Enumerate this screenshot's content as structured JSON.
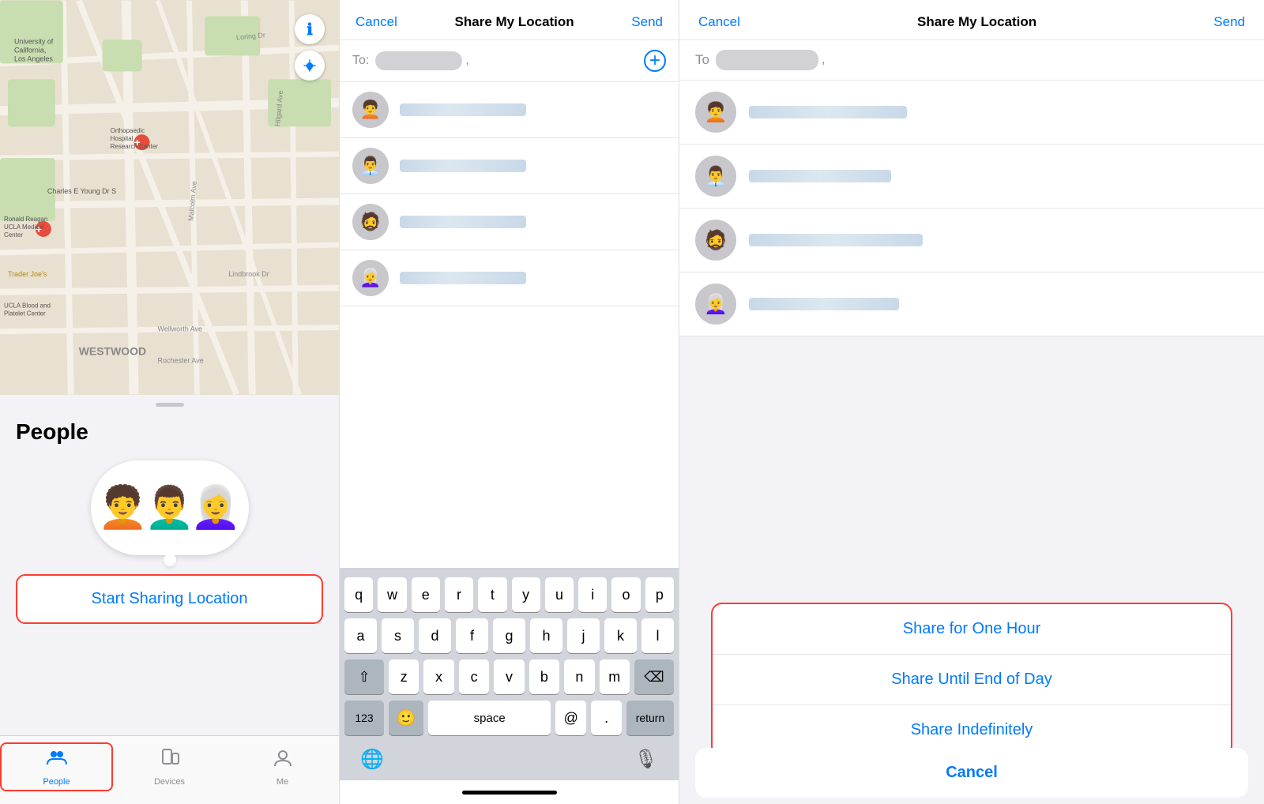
{
  "panel1": {
    "map": {
      "alt": "Map of Westwood area Los Angeles"
    },
    "drag_handle": true,
    "people_title": "People",
    "start_sharing_label": "Start Sharing Location",
    "tabs": [
      {
        "id": "people",
        "label": "People",
        "icon": "👤",
        "active": true
      },
      {
        "id": "devices",
        "label": "Devices",
        "icon": "📱",
        "active": false
      },
      {
        "id": "me",
        "label": "Me",
        "icon": "👤",
        "active": false
      }
    ]
  },
  "panel2": {
    "nav": {
      "cancel": "Cancel",
      "title": "Share My Location",
      "send": "Send"
    },
    "to_label": "To:",
    "add_btn": "+",
    "keyboard": {
      "rows": [
        [
          "q",
          "w",
          "e",
          "r",
          "t",
          "y",
          "u",
          "i",
          "o",
          "p"
        ],
        [
          "a",
          "s",
          "d",
          "f",
          "g",
          "h",
          "j",
          "k",
          "l"
        ],
        [
          "⇧",
          "z",
          "x",
          "c",
          "v",
          "b",
          "n",
          "m",
          "⌫"
        ],
        [
          "123",
          "🙂",
          "space",
          "@",
          ".",
          "return"
        ]
      ]
    },
    "contacts": [
      {
        "id": 1,
        "emoji": "🧑‍🦱"
      },
      {
        "id": 2,
        "emoji": "👨‍💼"
      },
      {
        "id": 3,
        "emoji": "🧔"
      },
      {
        "id": 4,
        "emoji": "👩‍🦳"
      }
    ]
  },
  "panel3": {
    "nav": {
      "cancel": "Cancel",
      "title": "Share My Location",
      "send": "Send"
    },
    "to_label": "To",
    "contacts": [
      {
        "id": 1,
        "emoji": "🧑‍🦱"
      },
      {
        "id": 2,
        "emoji": "👨‍💼"
      },
      {
        "id": 3,
        "emoji": "🧔"
      },
      {
        "id": 4,
        "emoji": "👩‍🦳"
      }
    ],
    "action_sheet": {
      "items": [
        {
          "id": "one-hour",
          "label": "Share for One Hour"
        },
        {
          "id": "end-of-day",
          "label": "Share Until End of Day"
        },
        {
          "id": "indefinitely",
          "label": "Share Indefinitely"
        }
      ],
      "cancel_label": "Cancel"
    }
  }
}
